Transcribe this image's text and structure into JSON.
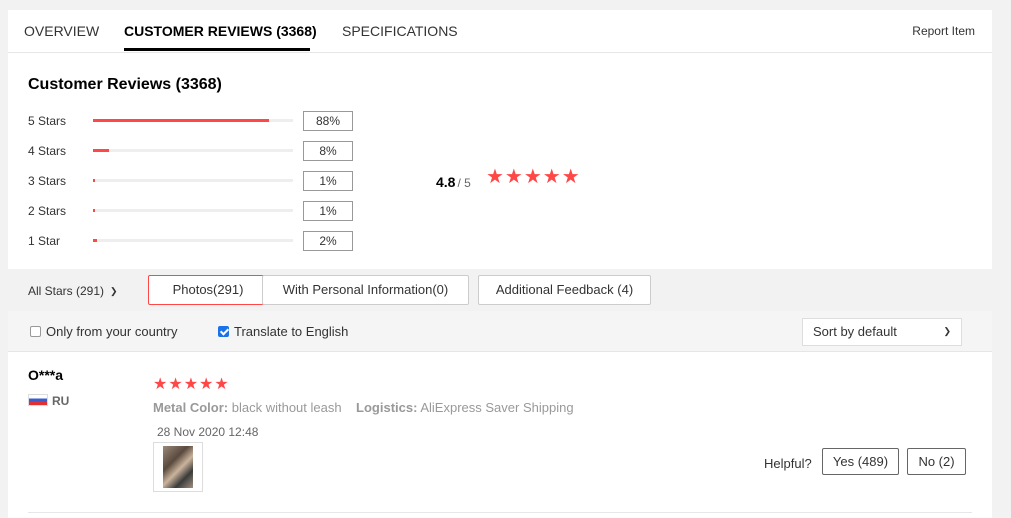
{
  "tabs": [
    {
      "label": "OVERVIEW"
    },
    {
      "label": "CUSTOMER REVIEWS (3368)",
      "active": true
    },
    {
      "label": "SPECIFICATIONS"
    }
  ],
  "report_label": "Report Item",
  "summary": {
    "title": "Customer Reviews (3368)",
    "distribution": [
      {
        "label": "5 Stars",
        "percent": 88,
        "percent_text": "88%"
      },
      {
        "label": "4 Stars",
        "percent": 8,
        "percent_text": "8%"
      },
      {
        "label": "3 Stars",
        "percent": 1,
        "percent_text": "1%"
      },
      {
        "label": "2 Stars",
        "percent": 1,
        "percent_text": "1%"
      },
      {
        "label": "1 Star",
        "percent": 2,
        "percent_text": "2%"
      }
    ],
    "average": "4.8",
    "max": "/ 5",
    "stars": "★★★★★"
  },
  "filters": {
    "stars_select": "All Stars (291)",
    "buttons": [
      {
        "label": "Photos(291)",
        "active": true
      },
      {
        "label": "With Personal Information(0)"
      },
      {
        "label": "Additional Feedback (4)"
      }
    ]
  },
  "options": {
    "only_country": {
      "label": "Only from your country",
      "checked": false
    },
    "translate": {
      "label": "Translate to English",
      "checked": true
    },
    "sort": "Sort by default"
  },
  "review": {
    "name": "O***a",
    "country": "RU",
    "stars": "★★★★★",
    "attr1_key": "Metal Color:",
    "attr1_val": "black without leash",
    "attr2_key": "Logistics:",
    "attr2_val": "AliExpress Saver Shipping",
    "date": "28 Nov 2020 12:48",
    "helpful_label": "Helpful?",
    "yes_label": "Yes (489)",
    "no_label": "No (2)"
  },
  "colors": {
    "accent": "#ff4747",
    "checkbox": "#1a73e8"
  },
  "icons": {
    "dropdown": "chevron-down-icon",
    "flag": "russia-flag-icon",
    "star": "star-icon"
  }
}
